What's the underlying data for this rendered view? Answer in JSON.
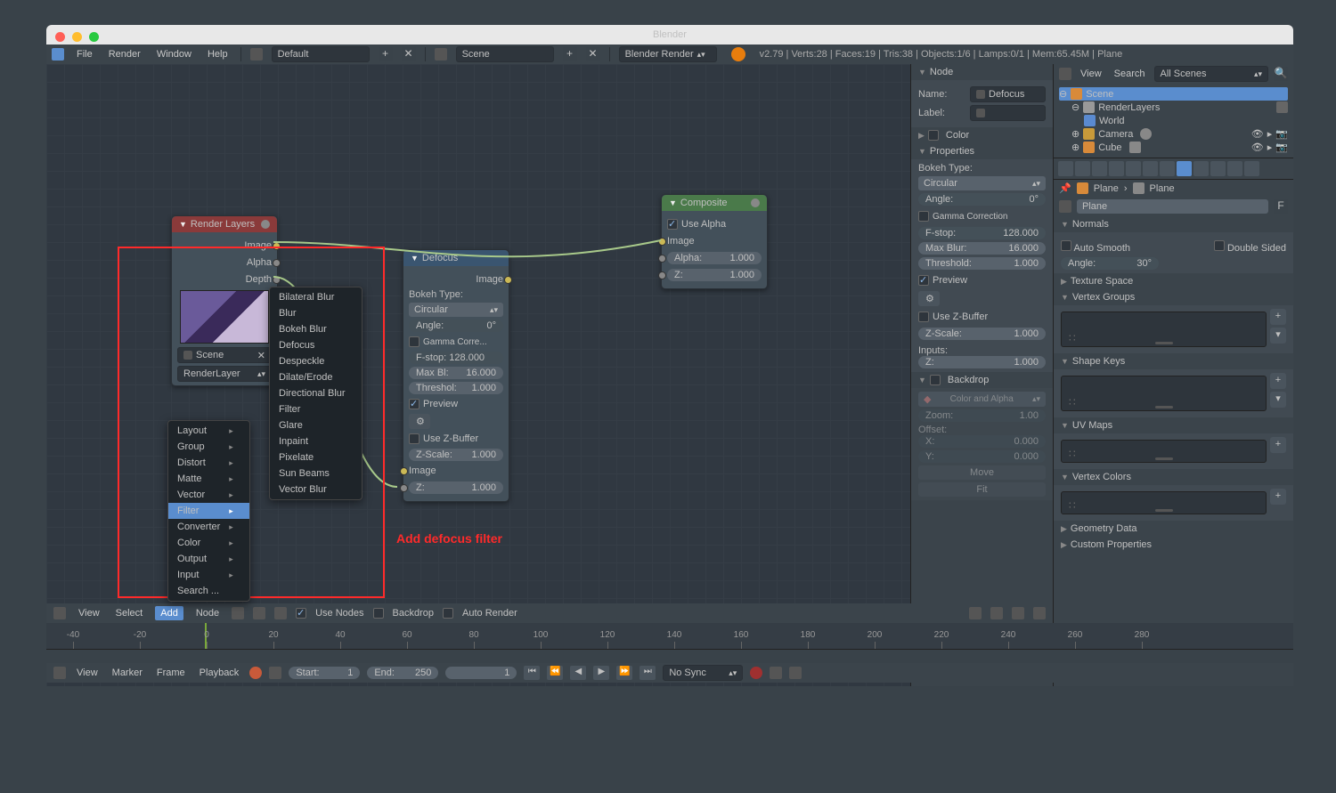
{
  "title": "Blender",
  "menu": {
    "file": "File",
    "render": "Render",
    "window": "Window",
    "help": "Help"
  },
  "layout_name": "Default",
  "scene_name": "Scene",
  "engine": "Blender Render",
  "stats": "v2.79 | Verts:28 | Faces:19 | Tris:38 | Objects:1/6 | Lamps:0/1 | Mem:65.45M | Plane",
  "annotation": "Add defocus filter",
  "scene_label": "Scene",
  "node_panel": {
    "title": "Node",
    "name_lbl": "Name:",
    "name_val": "Defocus",
    "label_lbl": "Label:",
    "color": "Color",
    "properties": "Properties",
    "bokeh_lbl": "Bokeh Type:",
    "bokeh_val": "Circular",
    "angle": "Angle:",
    "angle_v": "0°",
    "gamma": "Gamma Correction",
    "fstop": "F-stop:",
    "fstop_v": "128.000",
    "maxblur": "Max Blur:",
    "maxblur_v": "16.000",
    "thresh": "Threshold:",
    "thresh_v": "1.000",
    "preview": "Preview",
    "usez": "Use Z-Buffer",
    "zscale": "Z-Scale:",
    "zscale_v": "1.000",
    "inputs": "Inputs:",
    "z": "Z:",
    "z_v": "1.000",
    "backdrop": "Backdrop",
    "color_alpha": "Color and Alpha",
    "zoom": "Zoom:",
    "zoom_v": "1.00",
    "offset": "Offset:",
    "x": "X:",
    "x_v": "0.000",
    "y": "Y:",
    "y_v": "0.000",
    "move": "Move",
    "fit": "Fit"
  },
  "render_layers_node": {
    "title": "Render Layers",
    "out_image": "Image",
    "out_alpha": "Alpha",
    "out_depth": "Depth",
    "scene": "Scene",
    "rlayer": "RenderLayer"
  },
  "defocus_node": {
    "title": "Defocus",
    "out_image": "Image",
    "bokeh_lbl": "Bokeh Type:",
    "bokeh_val": "Circular",
    "angle": "Angle:",
    "angle_v": "0°",
    "gamma": "Gamma Corre...",
    "fstop": "F-stop: 128.000",
    "maxblur": "Max Bl:",
    "maxblur_v": "16.000",
    "thresh": "Threshol:",
    "thresh_v": "1.000",
    "preview": "Preview",
    "usez": "Use Z-Buffer",
    "zscale": "Z-Scale:",
    "zscale_v": "1.000",
    "in_image": "Image",
    "z": "Z:",
    "z_v": "1.000"
  },
  "composite_node": {
    "title": "Composite",
    "use_alpha": "Use Alpha",
    "in_image": "Image",
    "alpha": "Alpha:",
    "alpha_v": "1.000",
    "z": "Z:",
    "z_v": "1.000"
  },
  "add_menu": [
    "Layout",
    "Group",
    "Distort",
    "Matte",
    "Vector",
    "Filter",
    "Converter",
    "Color",
    "Output",
    "Input",
    "Search ..."
  ],
  "filter_menu": [
    "Bilateral Blur",
    "Blur",
    "Bokeh Blur",
    "Defocus",
    "Despeckle",
    "Dilate/Erode",
    "Directional Blur",
    "Filter",
    "Glare",
    "Inpaint",
    "Pixelate",
    "Sun Beams",
    "Vector Blur"
  ],
  "node_editor_bar": {
    "view": "View",
    "select": "Select",
    "add": "Add",
    "node": "Node",
    "use_nodes": "Use Nodes",
    "backdrop": "Backdrop",
    "auto_render": "Auto Render"
  },
  "outliner": {
    "view": "View",
    "search": "Search",
    "all_scenes": "All Scenes",
    "scene": "Scene",
    "render_layers": "RenderLayers",
    "world": "World",
    "camera": "Camera",
    "cube": "Cube"
  },
  "props": {
    "plane": "Plane",
    "plane2": "Plane",
    "name": "Plane",
    "f": "F",
    "normals": "Normals",
    "auto_smooth": "Auto Smooth",
    "double_sided": "Double Sided",
    "angle": "Angle:",
    "angle_v": "30°",
    "tex_space": "Texture Space",
    "vgroups": "Vertex Groups",
    "shape_keys": "Shape Keys",
    "uv_maps": "UV Maps",
    "vcolors": "Vertex Colors",
    "geo": "Geometry Data",
    "custom": "Custom Properties"
  },
  "timeline": {
    "view": "View",
    "marker": "Marker",
    "frame": "Frame",
    "playback": "Playback",
    "start": "Start:",
    "start_v": "1",
    "end": "End:",
    "end_v": "250",
    "cur_v": "1",
    "no_sync": "No Sync",
    "ticks": [
      "-40",
      "-20",
      "0",
      "20",
      "40",
      "60",
      "80",
      "100",
      "120",
      "140",
      "160",
      "180",
      "200",
      "220",
      "240",
      "260",
      "280"
    ]
  }
}
